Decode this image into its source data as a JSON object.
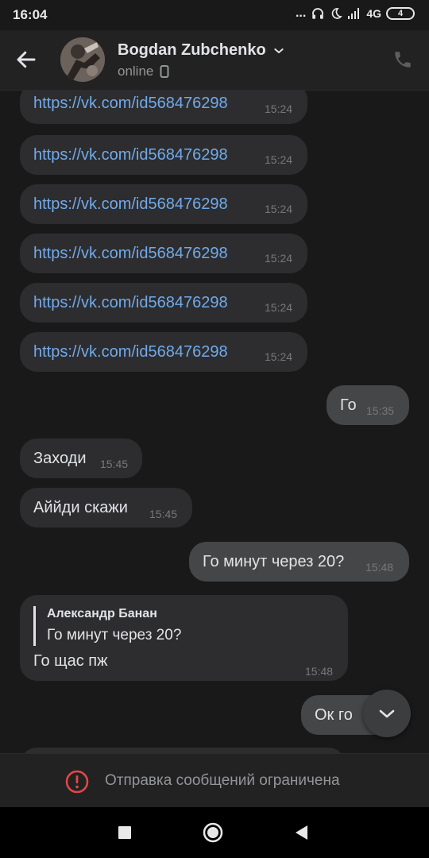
{
  "status_bar": {
    "time": "16:04",
    "dots": "...",
    "network": "4G",
    "battery": "4"
  },
  "header": {
    "name": "Bogdan Zubchenko",
    "status": "online",
    "icons": {
      "back": "arrow-left-icon",
      "dropdown": "chevron-down-icon",
      "device": "mobile-device-icon",
      "call": "phone-icon"
    }
  },
  "messages": [
    {
      "text": "https://vk.com/id568476298",
      "time": "15:24"
    },
    {
      "text": "https://vk.com/id568476298",
      "time": "15:24"
    },
    {
      "text": "https://vk.com/id568476298",
      "time": "15:24"
    },
    {
      "text": "https://vk.com/id568476298",
      "time": "15:24"
    },
    {
      "text": "https://vk.com/id568476298",
      "time": "15:24"
    },
    {
      "text": "https://vk.com/id568476298",
      "time": "15:24"
    },
    {
      "text": "Го",
      "time": "15:35"
    },
    {
      "text": "Заходи",
      "time": "15:45"
    },
    {
      "text": "Аййди скажи",
      "time": "15:45"
    },
    {
      "text": "Го минут через 20?",
      "time": "15:48"
    },
    {
      "reply_author": "Александр Банан",
      "reply_text": "Го минут через 20?",
      "text": "Го щас пж",
      "time": "15:48"
    },
    {
      "text": "Ок го",
      "time": ""
    }
  ],
  "restriction": {
    "icon": "warning-circle-icon",
    "text": "Отправка сообщений ограничена"
  },
  "colors": {
    "background": "#19191a",
    "incoming_bubble": "#2d2d2f",
    "outgoing_bubble": "#454647",
    "link": "#71aaeb",
    "warning": "#e64646"
  }
}
